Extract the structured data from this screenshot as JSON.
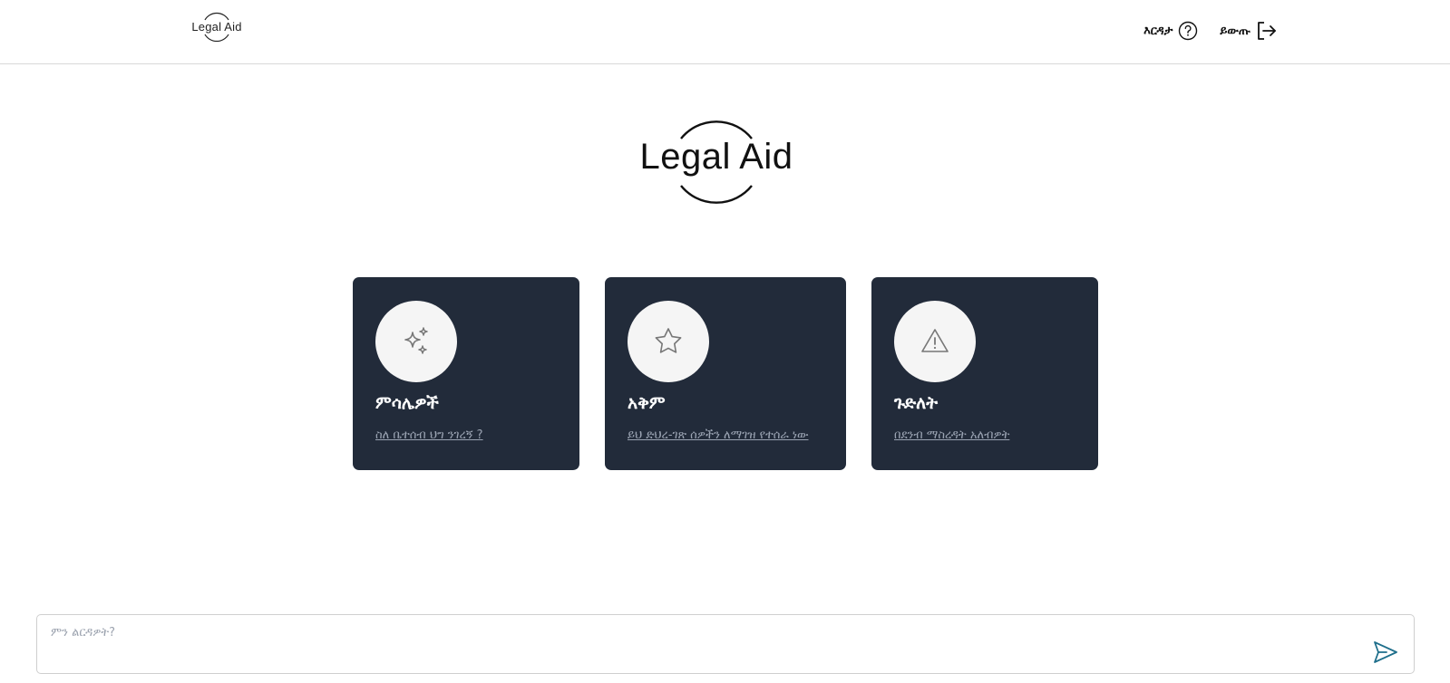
{
  "header": {
    "logo_text": "Legal Aid",
    "help_label": "እርዳታ",
    "logout_label": "ይውጡ"
  },
  "hero": {
    "logo_text": "Legal Aid"
  },
  "cards": [
    {
      "title": "ምሳሌዎች",
      "link": "ስለ ቤተሰብ ህግ ንገረኝ ?",
      "icon": "sparkles-icon"
    },
    {
      "title": "አቅም",
      "link": "ይህ ድህረ-ገጽ ሰዎችን ለማገዝ የተሰራ ነው",
      "icon": "star-icon"
    },
    {
      "title": "ጉድለት",
      "link": "በደንብ ማስረዳት አለብዎት",
      "icon": "warning-icon"
    }
  ],
  "composer": {
    "placeholder": "ምን ልርዳዎት?",
    "value": ""
  },
  "colors": {
    "card_bg": "#222b3a",
    "send_icon": "#1f6f8b"
  }
}
